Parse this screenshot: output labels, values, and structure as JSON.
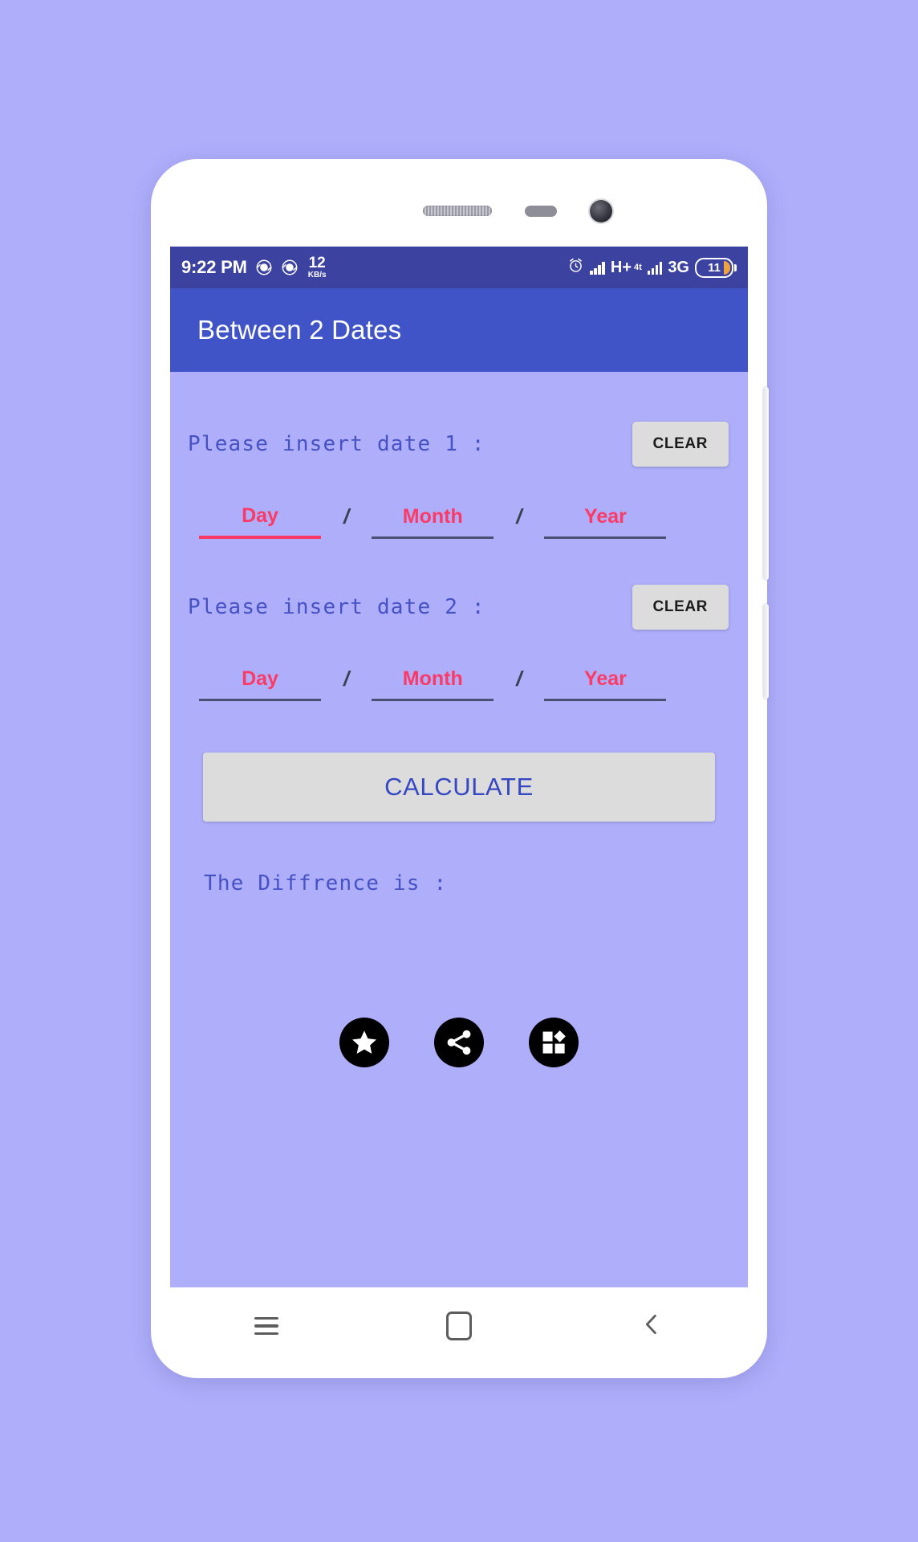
{
  "theme": {
    "page_background": "#aeaefb",
    "status_bar_color": "#3c42a0",
    "app_bar_color": "#4054c8",
    "accent_pink": "#fb3b66",
    "label_blue": "#4651c4",
    "button_gray": "#dcdcdc"
  },
  "status_bar": {
    "clock": "9:22 PM",
    "sync_icon_1": "sync-circle-icon",
    "sync_icon_2": "sync-circle-icon",
    "net_speed_value": "12",
    "net_speed_unit": "KB/s",
    "alarm_icon": "alarm-clock-icon",
    "signal_1_icon": "signal-bars-icon",
    "network_type_1": "H+",
    "network_type_1_sub": "4t",
    "signal_2_icon": "signal-bars-icon",
    "network_type_2": "3G",
    "battery_level": "11",
    "battery_icon": "battery-icon"
  },
  "app_bar": {
    "title": "Between 2 Dates"
  },
  "content": {
    "date1": {
      "prompt": "Please insert date 1 :",
      "clear_label": "CLEAR",
      "day": {
        "placeholder": "Day",
        "value": "",
        "focused": true
      },
      "month": {
        "placeholder": "Month",
        "value": "",
        "focused": false
      },
      "year": {
        "placeholder": "Year",
        "value": "",
        "focused": false
      }
    },
    "date2": {
      "prompt": "Please insert date 2 :",
      "clear_label": "CLEAR",
      "day": {
        "placeholder": "Day",
        "value": "",
        "focused": false
      },
      "month": {
        "placeholder": "Month",
        "value": "",
        "focused": false
      },
      "year": {
        "placeholder": "Year",
        "value": "",
        "focused": false
      }
    },
    "separator": "/",
    "calculate_label": "CALCULATE",
    "difference_label": "The Diffrence is :",
    "difference_value": "",
    "action_icons": [
      {
        "name": "rate-star-icon",
        "label": "star"
      },
      {
        "name": "share-icon",
        "label": "share"
      },
      {
        "name": "more-apps-grid-icon",
        "label": "apps"
      }
    ]
  },
  "nav_bar": {
    "menu_icon": "menu-icon",
    "home_icon": "home-icon",
    "back_icon": "back-chevron-icon"
  },
  "device": {
    "earpiece": "earpiece-speaker",
    "proximity": "proximity-sensor",
    "camera": "front-camera",
    "volume_button": "volume-button",
    "power_button": "power-button"
  }
}
